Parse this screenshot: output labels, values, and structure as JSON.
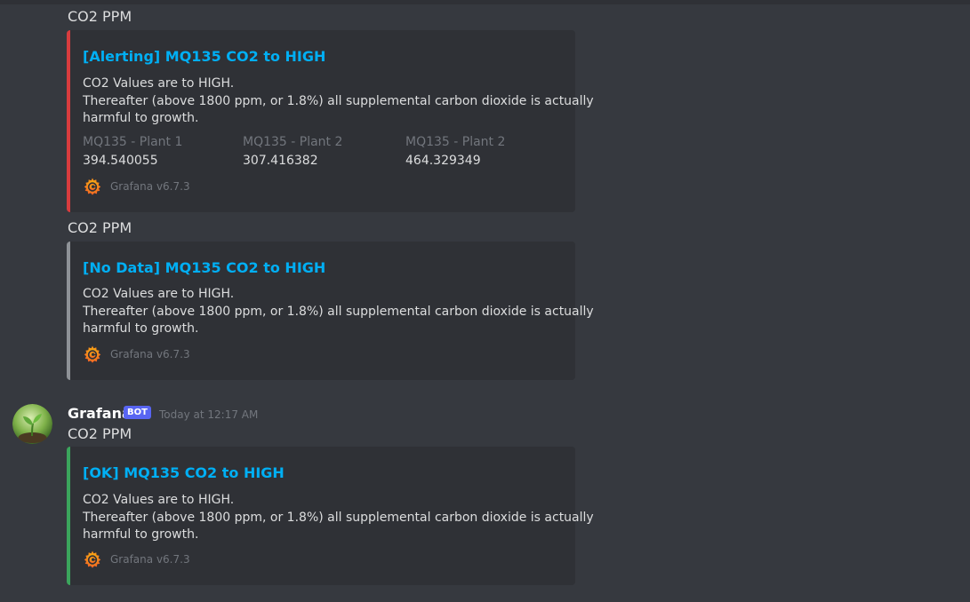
{
  "colors": {
    "alerting": "#d83c3e",
    "nodata": "#8e9297",
    "ok": "#3ba55c",
    "link": "#00aff4"
  },
  "messages": [
    {
      "content": "CO2 PPM",
      "embed": {
        "title": "[Alerting] MQ135  CO2 to HIGH",
        "description_lines": [
          "CO2 Values are to HIGH.",
          "Thereafter (above 1800 ppm, or 1.8%) all supplemental carbon dioxide is actually",
          "harmful to growth."
        ],
        "fields": [
          {
            "name": "MQ135 - Plant 1",
            "value": "394.540055"
          },
          {
            "name": "MQ135 - Plant 2",
            "value": "307.416382"
          },
          {
            "name": "MQ135 - Plant 2",
            "value": "464.329349"
          }
        ],
        "footer": "Grafana v6.7.3",
        "footer_icon": "grafana-logo-icon"
      }
    },
    {
      "content": "CO2 PPM",
      "embed": {
        "title": "[No Data] MQ135  CO2 to HIGH",
        "description_lines": [
          "CO2 Values are to HIGH.",
          "Thereafter (above 1800 ppm, or 1.8%) all supplemental carbon dioxide is actually",
          "harmful to growth."
        ],
        "footer": "Grafana v6.7.3",
        "footer_icon": "grafana-logo-icon"
      }
    },
    {
      "author": "Grafana",
      "badge": "BOT",
      "timestamp": "Today at 12:17 AM",
      "avatar_icon": "plant-sprout-avatar",
      "content": "CO2 PPM",
      "embed": {
        "title": "[OK] MQ135  CO2 to HIGH",
        "description_lines": [
          "CO2 Values are to HIGH.",
          "Thereafter (above 1800 ppm, or 1.8%) all supplemental carbon dioxide is actually",
          "harmful to growth."
        ],
        "footer": "Grafana v6.7.3",
        "footer_icon": "grafana-logo-icon"
      }
    }
  ]
}
